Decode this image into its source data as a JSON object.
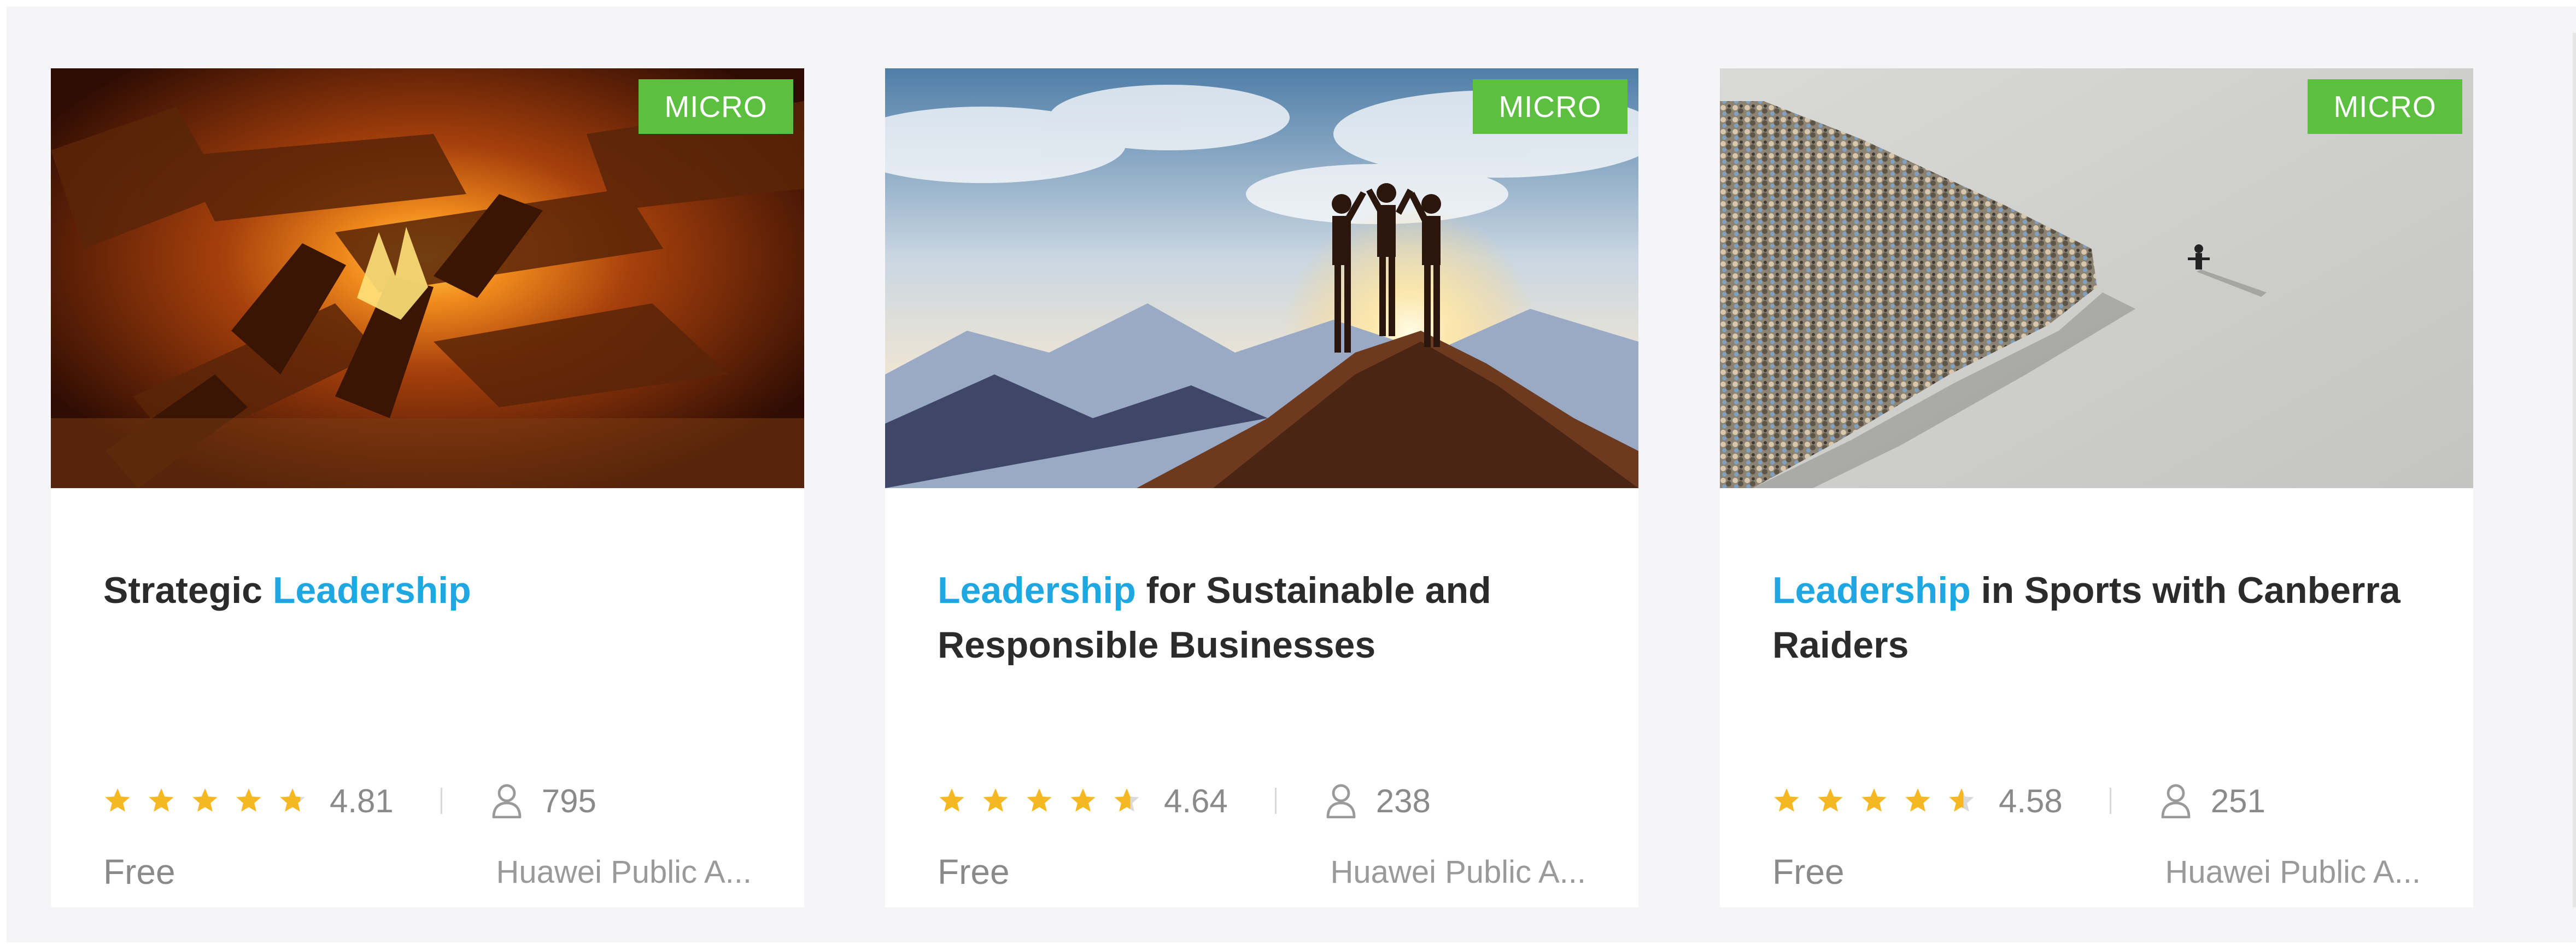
{
  "courses": [
    {
      "badge": "MICRO",
      "title_prefix": "Strategic ",
      "title_highlight": "Leadership",
      "title_suffix": "",
      "rating": "4.81",
      "rating_value": 4.81,
      "enrolled": "795",
      "price": "Free",
      "provider": "Huawei Public A...",
      "thumbnail_icon": "campfire-image"
    },
    {
      "badge": "MICRO",
      "title_prefix": "",
      "title_highlight": "Leadership",
      "title_suffix": " for Sustainable and Responsible Businesses",
      "rating": "4.64",
      "rating_value": 4.64,
      "enrolled": "238",
      "price": "Free",
      "provider": "Huawei Public A...",
      "thumbnail_icon": "mountain-summit-image"
    },
    {
      "badge": "MICRO",
      "title_prefix": "",
      "title_highlight": "Leadership",
      "title_suffix": " in Sports with Canberra Raiders",
      "rating": "4.58",
      "rating_value": 4.58,
      "enrolled": "251",
      "price": "Free",
      "provider": "Huawei Public A...",
      "thumbnail_icon": "crowd-leader-image"
    }
  ],
  "colors": {
    "badge": "#5cbf3f",
    "highlight": "#1ea7e1",
    "star": "#f5b823",
    "star_empty": "#d9d9d9"
  },
  "icons": {
    "star": "star-icon",
    "enrolled": "user-icon"
  }
}
